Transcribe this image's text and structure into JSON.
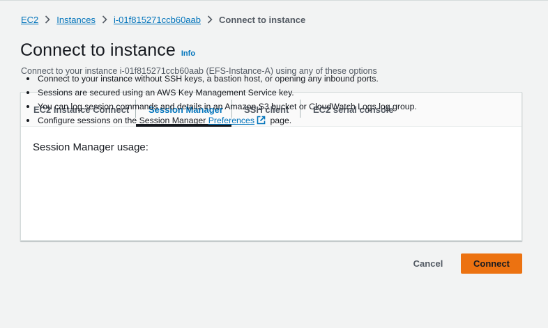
{
  "breadcrumb": {
    "items": [
      "EC2",
      "Instances",
      "i-01f815271ccb60aab"
    ],
    "current": "Connect to instance"
  },
  "header": {
    "title": "Connect to instance",
    "info": "Info",
    "subtitle": "Connect to your instance i-01f815271ccb60aab (EFS-Instance-A) using any of these options"
  },
  "tabs": [
    {
      "label": "EC2 Instance Connect",
      "active": false
    },
    {
      "label": "Session Manager",
      "active": true
    },
    {
      "label": "SSH client",
      "active": false
    },
    {
      "label": "EC2 serial console",
      "active": false
    }
  ],
  "session_manager": {
    "heading": "Session Manager usage:",
    "bullets": [
      "Connect to your instance without SSH keys, a bastion host, or opening any inbound ports.",
      "Sessions are secured using an AWS Key Management Service key.",
      "You can log session commands and details in an Amazon S3 bucket or CloudWatch Logs log group."
    ],
    "last_bullet": {
      "before": "Configure sessions on the Session Manager ",
      "link": "Preferences",
      "after": " page."
    }
  },
  "actions": {
    "cancel": "Cancel",
    "connect": "Connect"
  },
  "colors": {
    "accent": "#0073bb",
    "primary_button": "#ec7211",
    "background": "#f2f3f3"
  },
  "icons": {
    "breadcrumb_separator": "chevron-right-icon",
    "external_link": "external-link-icon"
  }
}
